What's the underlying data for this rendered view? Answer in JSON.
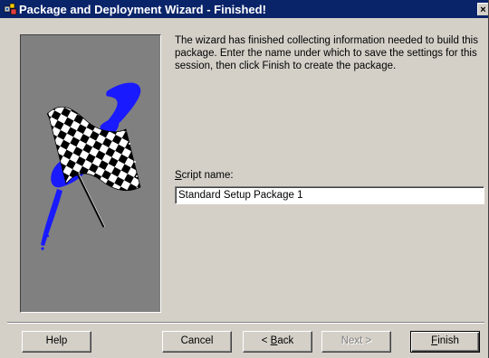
{
  "window": {
    "title": "Package and Deployment Wizard - Finished!",
    "close_symbol": "×"
  },
  "content": {
    "description": "The wizard has finished collecting information needed to build this package. Enter the name under which to save the settings for this session, then click Finish to create the package.",
    "script_label_access": "S",
    "script_label_rest": "cript name:",
    "script_name_value": "Standard Setup Package 1"
  },
  "buttons": {
    "help": "Help",
    "cancel": "Cancel",
    "back_access": "B",
    "back_rest": "ack",
    "back_prefix": "< ",
    "next": "Next >",
    "finish_access": "F",
    "finish_rest": "inish"
  },
  "icons": {
    "title": "package-wizard-icon",
    "illustration": "checkered-flag-icon"
  },
  "colors": {
    "titlebar": "#0a246a",
    "dialog_face": "#d4d0c8",
    "illustration_bg": "#808080",
    "flag_splash": "#1a1aff"
  }
}
